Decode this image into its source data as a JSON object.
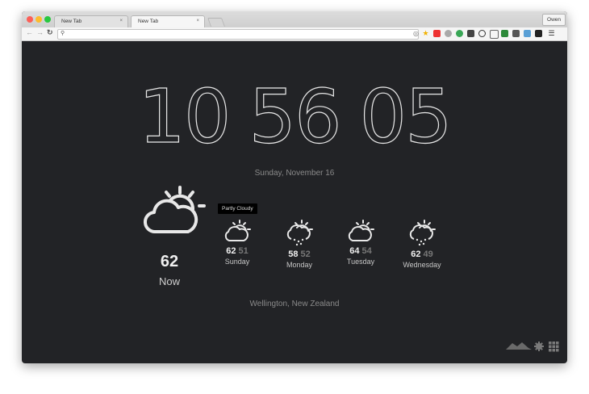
{
  "browser": {
    "tabs": [
      {
        "title": "New Tab",
        "active": false
      },
      {
        "title": "New Tab",
        "active": true
      }
    ],
    "profile": "Owen",
    "close_glyph": "×"
  },
  "clock": {
    "hours": "10",
    "minutes": "56",
    "seconds": "05"
  },
  "date": "Sunday, November 16",
  "current": {
    "temp": "62",
    "label": "Now",
    "condition": "Partly Cloudy"
  },
  "forecast": [
    {
      "high": "62",
      "low": "51",
      "day": "Sunday",
      "icon": "partly-cloudy-icon"
    },
    {
      "high": "58",
      "low": "52",
      "day": "Monday",
      "icon": "rain-icon"
    },
    {
      "high": "64",
      "low": "54",
      "day": "Tuesday",
      "icon": "partly-cloudy-icon"
    },
    {
      "high": "62",
      "low": "49",
      "day": "Wednesday",
      "icon": "rain-icon"
    }
  ],
  "location": "Wellington, New Zealand",
  "colors": {
    "background": "#222326",
    "text": "#e9e9e9",
    "muted": "#8a8a8a"
  }
}
